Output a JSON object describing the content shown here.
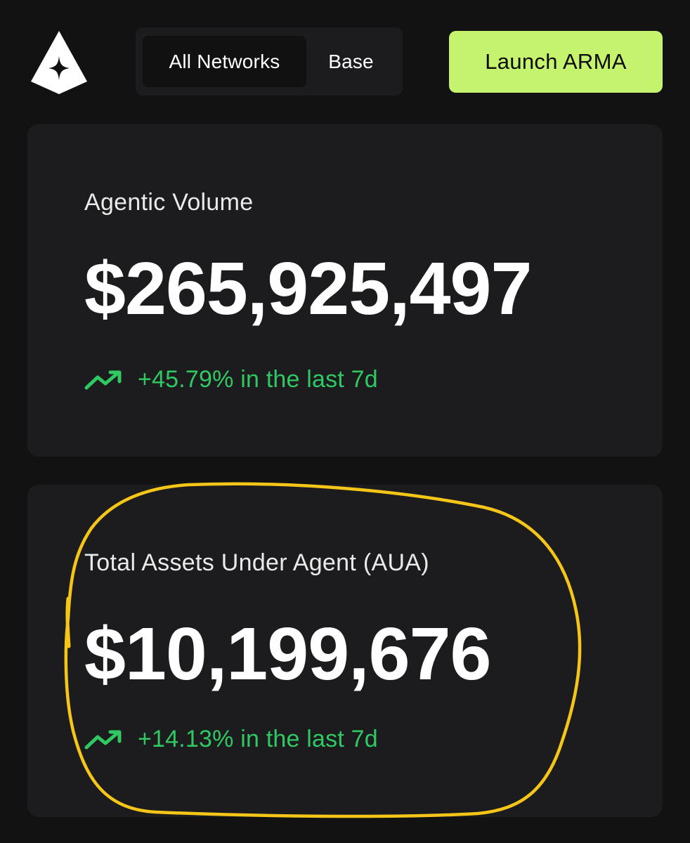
{
  "header": {
    "logo_icon": "arma-logo-icon",
    "network_tabs": [
      {
        "label": "All Networks",
        "active": true
      },
      {
        "label": "Base",
        "active": false
      }
    ],
    "launch_button_label": "Launch ARMA"
  },
  "stats": {
    "agentic_volume": {
      "label": "Agentic Volume",
      "value": "$265,925,497",
      "change": "+45.79% in the last 7d",
      "trend_icon": "trending-up-icon"
    },
    "aua": {
      "label": "Total Assets Under Agent (AUA)",
      "value": "$10,199,676",
      "change": "+14.13% in the last 7d",
      "trend_icon": "trending-up-icon"
    }
  },
  "colors": {
    "background": "#121212",
    "card": "#1c1c1e",
    "accent_button": "#c6f36e",
    "positive": "#2fc862",
    "annotation": "#f5c518"
  }
}
